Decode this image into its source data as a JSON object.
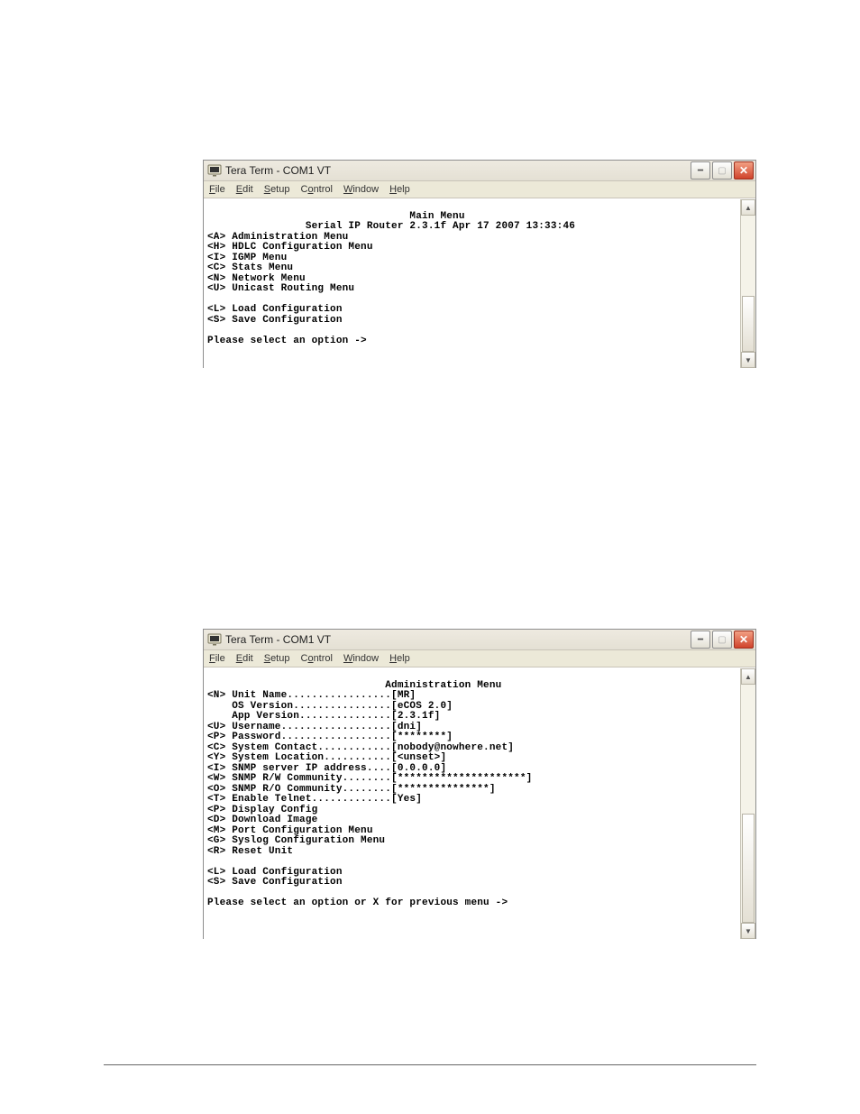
{
  "window1": {
    "title": "Tera Term - COM1 VT",
    "menus": {
      "file": "File",
      "edit": "Edit",
      "setup": "Setup",
      "control": "Control",
      "window": "Window",
      "help": "Help"
    },
    "term": "\n                                 Main Menu\n                Serial IP Router 2.3.1f Apr 17 2007 13:33:46\n<A> Administration Menu\n<H> HDLC Configuration Menu\n<I> IGMP Menu\n<C> Stats Menu\n<N> Network Menu\n<U> Unicast Routing Menu\n\n<L> Load Configuration\n<S> Save Configuration\n\nPlease select an option ->"
  },
  "window2": {
    "title": "Tera Term - COM1 VT",
    "menus": {
      "file": "File",
      "edit": "Edit",
      "setup": "Setup",
      "control": "Control",
      "window": "Window",
      "help": "Help"
    },
    "term": "\n                             Administration Menu\n<N> Unit Name.................[MR]\n    OS Version................[eCOS 2.0]\n    App Version...............[2.3.1f]\n<U> Username..................[dni]\n<P> Password..................[********]\n<C> System Contact............[nobody@nowhere.net]\n<Y> System Location...........[<unset>]\n<I> SNMP server IP address....[0.0.0.0]\n<W> SNMP R/W Community........[*********************]\n<O> SNMP R/O Community........[***************]\n<T> Enable Telnet.............[Yes]\n<P> Display Config\n<D> Download Image\n<M> Port Configuration Menu\n<G> Syslog Configuration Menu\n<R> Reset Unit\n\n<L> Load Configuration\n<S> Save Configuration\n\nPlease select an option or X for previous menu ->"
  },
  "terminal1": {
    "heading": "Main Menu",
    "subheading": "Serial IP Router 2.3.1f Apr 17 2007 13:33:46",
    "options": [
      {
        "key": "A",
        "label": "Administration Menu"
      },
      {
        "key": "H",
        "label": "HDLC Configuration Menu"
      },
      {
        "key": "I",
        "label": "IGMP Menu"
      },
      {
        "key": "C",
        "label": "Stats Menu"
      },
      {
        "key": "N",
        "label": "Network Menu"
      },
      {
        "key": "U",
        "label": "Unicast Routing Menu"
      }
    ],
    "footer_options": [
      {
        "key": "L",
        "label": "Load Configuration"
      },
      {
        "key": "S",
        "label": "Save Configuration"
      }
    ],
    "prompt": "Please select an option ->"
  },
  "terminal2": {
    "heading": "Administration Menu",
    "fields": [
      {
        "key": "N",
        "label": "Unit Name",
        "value": "MR"
      },
      {
        "key": "",
        "label": "OS Version",
        "value": "eCOS 2.0"
      },
      {
        "key": "",
        "label": "App Version",
        "value": "2.3.1f"
      },
      {
        "key": "U",
        "label": "Username",
        "value": "dni"
      },
      {
        "key": "P",
        "label": "Password",
        "value": "********"
      },
      {
        "key": "C",
        "label": "System Contact",
        "value": "nobody@nowhere.net"
      },
      {
        "key": "Y",
        "label": "System Location",
        "value": "<unset>"
      },
      {
        "key": "I",
        "label": "SNMP server IP address",
        "value": "0.0.0.0"
      },
      {
        "key": "W",
        "label": "SNMP R/W Community",
        "value": "*********************"
      },
      {
        "key": "O",
        "label": "SNMP R/O Community",
        "value": "***************"
      },
      {
        "key": "T",
        "label": "Enable Telnet",
        "value": "Yes"
      }
    ],
    "actions": [
      {
        "key": "P",
        "label": "Display Config"
      },
      {
        "key": "D",
        "label": "Download Image"
      },
      {
        "key": "M",
        "label": "Port Configuration Menu"
      },
      {
        "key": "G",
        "label": "Syslog Configuration Menu"
      },
      {
        "key": "R",
        "label": "Reset Unit"
      }
    ],
    "footer_options": [
      {
        "key": "L",
        "label": "Load Configuration"
      },
      {
        "key": "S",
        "label": "Save Configuration"
      }
    ],
    "prompt": "Please select an option or X for previous menu ->"
  }
}
